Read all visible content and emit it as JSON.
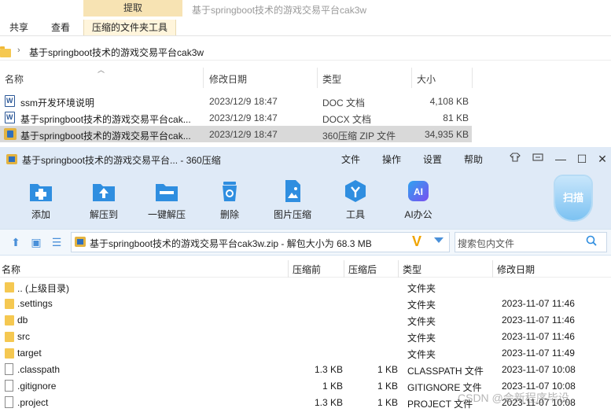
{
  "explorer": {
    "ribbon": {
      "context_tab_header": "提取",
      "tabs": [
        "共享",
        "查看",
        "压缩的文件夹工具"
      ]
    },
    "window_title": "基于springboot技术的游戏交易平台cak3w",
    "address": {
      "path": "基于springboot技术的游戏交易平台cak3w"
    },
    "columns": {
      "name": "名称",
      "modified": "修改日期",
      "type": "类型",
      "size": "大小"
    },
    "files": [
      {
        "name": "ssm开发环境说明",
        "modified": "2023/12/9 18:47",
        "type": "DOC 文档",
        "size": "4,108 KB",
        "icon": "word-doc-icon"
      },
      {
        "name": "基于springboot技术的游戏交易平台cak...",
        "modified": "2023/12/9 18:47",
        "type": "DOCX 文档",
        "size": "81 KB",
        "icon": "word-doc-icon"
      },
      {
        "name": "基于springboot技术的游戏交易平台cak...",
        "modified": "2023/12/9 18:47",
        "type": "360压缩 ZIP 文件",
        "size": "34,935 KB",
        "icon": "zip-archive-icon"
      }
    ]
  },
  "zip": {
    "title": "基于springboot技术的游戏交易平台... - 360压缩",
    "menu": [
      "文件",
      "操作",
      "设置",
      "帮助"
    ],
    "toolbar": [
      {
        "label": "添加",
        "icon": "add-icon"
      },
      {
        "label": "解压到",
        "icon": "extract-to-icon"
      },
      {
        "label": "一键解压",
        "icon": "one-click-extract-icon"
      },
      {
        "label": "删除",
        "icon": "delete-icon"
      },
      {
        "label": "图片压缩",
        "icon": "image-compress-icon"
      },
      {
        "label": "工具",
        "icon": "tools-icon"
      },
      {
        "label": "AI办公",
        "icon": "ai-office-icon"
      }
    ],
    "scan_label": "扫描",
    "path_text": "基于springboot技术的游戏交易平台cak3w.zip - 解包大小为 68.3 MB",
    "search_placeholder": "搜索包内文件",
    "columns": {
      "name": "名称",
      "compressed": "压缩前",
      "after": "压缩后",
      "type": "类型",
      "modified": "修改日期"
    },
    "entries": [
      {
        "name": ".. (上级目录)",
        "before": "",
        "after": "",
        "type": "文件夹",
        "modified": "",
        "kind": "folder"
      },
      {
        "name": ".settings",
        "before": "",
        "after": "",
        "type": "文件夹",
        "modified": "2023-11-07 11:46",
        "kind": "folder"
      },
      {
        "name": "db",
        "before": "",
        "after": "",
        "type": "文件夹",
        "modified": "2023-11-07 11:46",
        "kind": "folder"
      },
      {
        "name": "src",
        "before": "",
        "after": "",
        "type": "文件夹",
        "modified": "2023-11-07 11:46",
        "kind": "folder"
      },
      {
        "name": "target",
        "before": "",
        "after": "",
        "type": "文件夹",
        "modified": "2023-11-07 11:49",
        "kind": "folder"
      },
      {
        "name": ".classpath",
        "before": "1.3 KB",
        "after": "1 KB",
        "type": "CLASSPATH 文件",
        "modified": "2023-11-07 10:08",
        "kind": "file"
      },
      {
        "name": ".gitignore",
        "before": "1 KB",
        "after": "1 KB",
        "type": "GITIGNORE 文件",
        "modified": "2023-11-07 10:08",
        "kind": "file"
      },
      {
        "name": ".project",
        "before": "1.3 KB",
        "after": "1 KB",
        "type": "PROJECT 文件",
        "modified": "2023-11-07 10:08",
        "kind": "file"
      }
    ]
  },
  "watermark": "CSDN @会新程序毕设",
  "colors": {
    "zip_chrome": "#dfeaf7",
    "accent_blue": "#2f8ee0",
    "folder_yellow": "#f5c851",
    "selection_gray": "#d9d9d9"
  }
}
